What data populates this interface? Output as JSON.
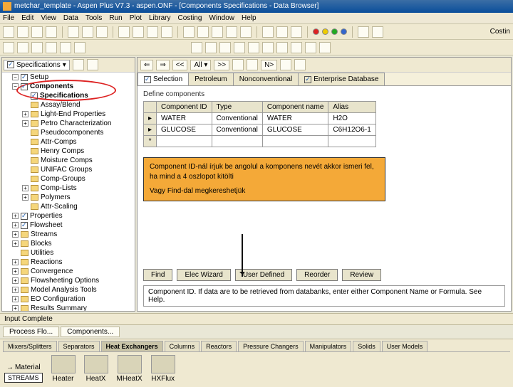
{
  "title": "metchar_template - Aspen Plus V7.3 - aspen.ONF - [Components Specifications - Data Browser]",
  "menu": [
    "File",
    "Edit",
    "View",
    "Data",
    "Tools",
    "Run",
    "Plot",
    "Library",
    "Costing",
    "Window",
    "Help"
  ],
  "costing_label": "Costin",
  "tree_top": "Specifications",
  "tree": {
    "root": "Setup",
    "components": "Components",
    "spec": "Specifications",
    "items": [
      "Assay/Blend",
      "Light-End Properties",
      "Petro Characterization",
      "Pseudocomponents",
      "Attr-Comps",
      "Henry Comps",
      "Moisture Comps",
      "UNIFAC Groups",
      "Comp-Groups",
      "Comp-Lists",
      "Polymers",
      "Attr-Scaling"
    ],
    "after": [
      "Properties",
      "Flowsheet",
      "Streams",
      "Blocks",
      "Utilities",
      "Reactions",
      "Convergence",
      "Flowsheeting Options",
      "Model Analysis Tools",
      "EO Configuration",
      "Results Summary"
    ]
  },
  "nav_all": "All",
  "tabs": {
    "selection": "Selection",
    "petroleum": "Petroleum",
    "nonconv": "Nonconventional",
    "db": "Enterprise Database"
  },
  "group": "Define components",
  "table": {
    "headers": [
      "Component ID",
      "Type",
      "Component name",
      "Alias"
    ],
    "rows": [
      [
        "WATER",
        "Conventional",
        "WATER",
        "H2O"
      ],
      [
        "GLUCOSE",
        "Conventional",
        "GLUCOSE",
        "C6H12O6-1"
      ]
    ]
  },
  "note1": "Component ID-nál írjuk be angolul a komponens nevét akkor ismeri fel, ha mind a 4 oszlopot kitölti",
  "note2": "Vagy Find-dal megkereshetjük",
  "buttons": {
    "find": "Find",
    "elec": "Elec Wizard",
    "user": "User Defined",
    "reorder": "Reorder",
    "review": "Review"
  },
  "hint": "Component ID. If data are to be retrieved from databanks, enter either Component Name or Formula. See Help.",
  "status": "Input Complete",
  "bottom_tabs": {
    "process": "Process Flo...",
    "components": "Components..."
  },
  "palette": {
    "tabs": [
      "Mixers/Splitters",
      "Separators",
      "Heat Exchangers",
      "Columns",
      "Reactors",
      "Pressure Changers",
      "Manipulators",
      "Solids",
      "User Models"
    ],
    "active": 2,
    "material": "Material",
    "stream": "STREAMS",
    "items": [
      "Heater",
      "HeatX",
      "MHeatX",
      "HXFlux"
    ]
  }
}
